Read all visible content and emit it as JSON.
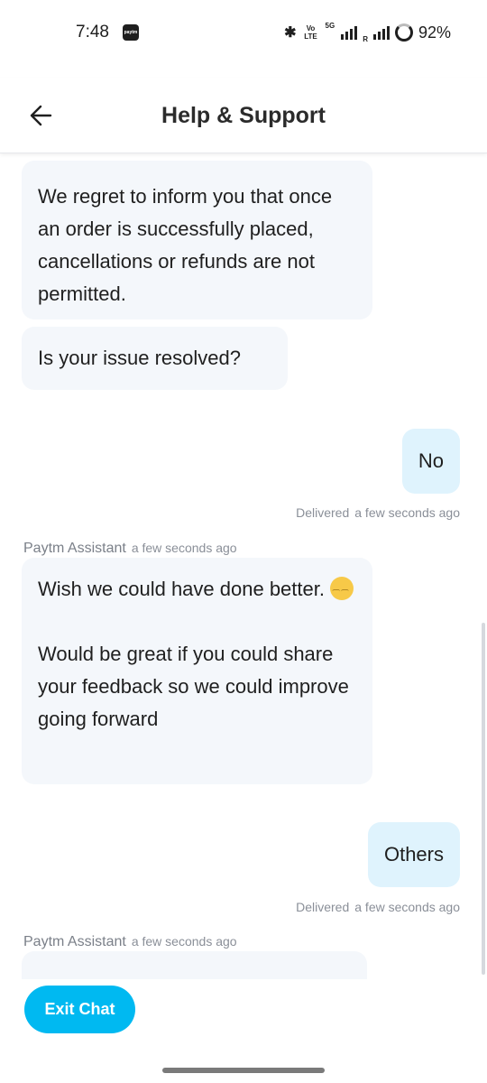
{
  "status_bar": {
    "time": "7:48",
    "app_icon_text": "paytm",
    "volte_top": "Vo",
    "volte_bottom": "LTE",
    "network": "5G",
    "roaming": "R",
    "battery_percent": "92%"
  },
  "header": {
    "title": "Help & Support",
    "back_icon": "back-arrow-icon"
  },
  "messages": [
    {
      "from": "assistant",
      "text": "We regret to inform you that once an order is successfully placed, cancellations or refunds are not permitted."
    },
    {
      "from": "assistant",
      "text": "Is your issue resolved?"
    },
    {
      "from": "user",
      "text": "No",
      "status": "Delivered",
      "time": "a few seconds ago"
    },
    {
      "from": "assistant",
      "sender": "Paytm Assistant",
      "time": "a few seconds ago",
      "text_line1": "Wish we could have done better.",
      "text_para2": "Would be great if you could share your feedback so we could improve going forward"
    },
    {
      "from": "user",
      "text": "Others",
      "status": "Delivered",
      "time": "a few seconds ago"
    },
    {
      "from": "assistant",
      "sender": "Paytm Assistant",
      "time": "a few seconds ago"
    }
  ],
  "footer": {
    "exit_label": "Exit Chat",
    "accent_color": "#00b9f1"
  }
}
